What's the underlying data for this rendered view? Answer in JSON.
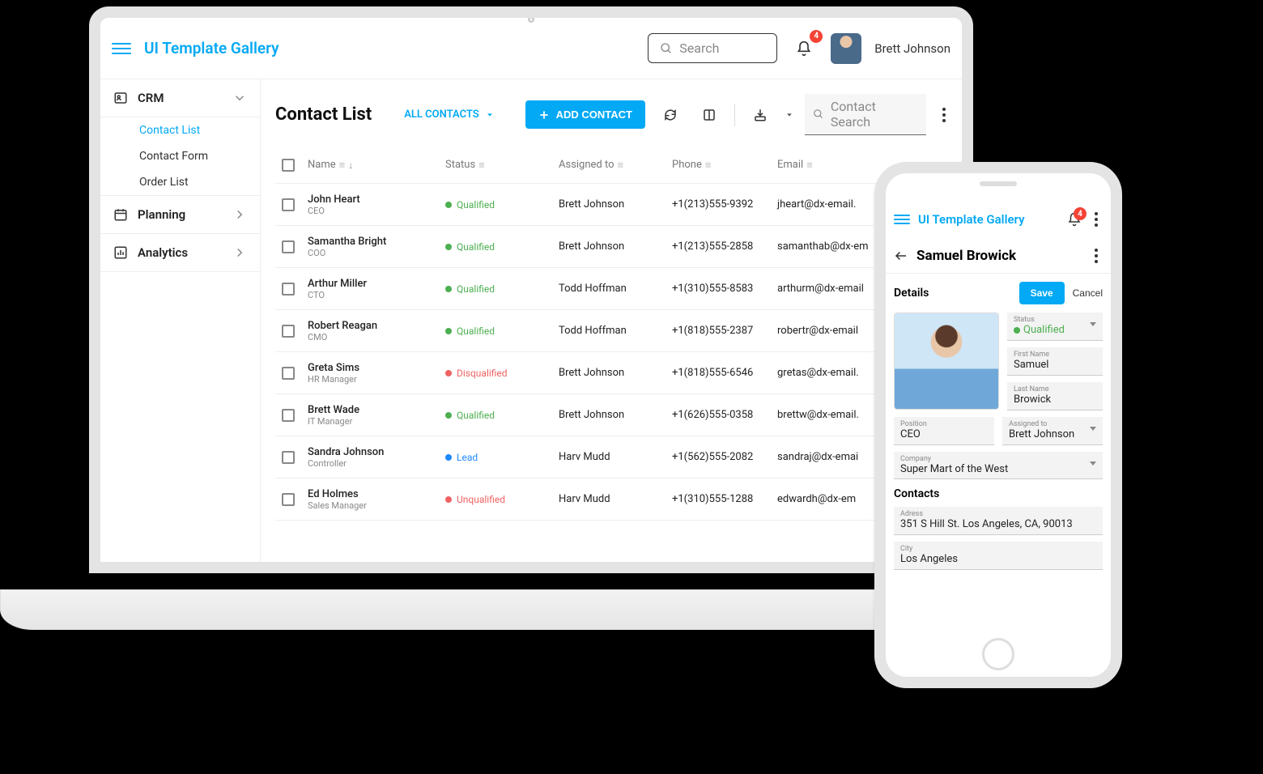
{
  "app_title": "UI Template Gallery",
  "search_placeholder": "Search",
  "notification_count": "4",
  "user_name": "Brett Johnson",
  "sidebar": {
    "sections": [
      {
        "label": "CRM",
        "icon": "contact-card-icon",
        "expanded": true,
        "items": [
          {
            "label": "Contact List",
            "active": true
          },
          {
            "label": "Contact Form",
            "active": false
          },
          {
            "label": "Order List",
            "active": false
          }
        ]
      },
      {
        "label": "Planning",
        "icon": "calendar-icon",
        "expanded": false,
        "items": []
      },
      {
        "label": "Analytics",
        "icon": "chart-icon",
        "expanded": false,
        "items": []
      }
    ]
  },
  "main": {
    "page_title": "Contact List",
    "filter_label": "ALL CONTACTS",
    "add_button_label": "ADD CONTACT",
    "contact_search_placeholder": "Contact Search",
    "columns": {
      "name": "Name",
      "status": "Status",
      "assigned": "Assigned to",
      "phone": "Phone",
      "email": "Email"
    },
    "rows": [
      {
        "name": "John Heart",
        "role": "CEO",
        "status": "Qualified",
        "assigned": "Brett Johnson",
        "phone": "+1(213)555-9392",
        "email": "jheart@dx-email."
      },
      {
        "name": "Samantha Bright",
        "role": "COO",
        "status": "Qualified",
        "assigned": "Brett Johnson",
        "phone": "+1(213)555-2858",
        "email": "samanthab@dx-em"
      },
      {
        "name": "Arthur Miller",
        "role": "CTO",
        "status": "Qualified",
        "assigned": "Todd Hoffman",
        "phone": "+1(310)555-8583",
        "email": "arthurm@dx-email"
      },
      {
        "name": "Robert Reagan",
        "role": "CMO",
        "status": "Qualified",
        "assigned": "Todd Hoffman",
        "phone": "+1(818)555-2387",
        "email": "robertr@dx-email"
      },
      {
        "name": "Greta Sims",
        "role": "HR Manager",
        "status": "Disqualified",
        "assigned": "Brett Johnson",
        "phone": "+1(818)555-6546",
        "email": "gretas@dx-email."
      },
      {
        "name": "Brett Wade",
        "role": "IT Manager",
        "status": "Qualified",
        "assigned": "Brett Johnson",
        "phone": "+1(626)555-0358",
        "email": "brettw@dx-email."
      },
      {
        "name": "Sandra Johnson",
        "role": "Controller",
        "status": "Lead",
        "assigned": "Harv Mudd",
        "phone": "+1(562)555-2082",
        "email": "sandraj@dx-emai"
      },
      {
        "name": "Ed Holmes",
        "role": "Sales Manager",
        "status": "Unqualified",
        "assigned": "Harv Mudd",
        "phone": "+1(310)555-1288",
        "email": "edwardh@dx-em"
      }
    ]
  },
  "phone": {
    "app_title": "UI Template Gallery",
    "notification_count": "4",
    "contact_name": "Samuel Browick",
    "details_label": "Details",
    "save_label": "Save",
    "cancel_label": "Cancel",
    "fields": {
      "status": {
        "label": "Status",
        "value": "Qualified"
      },
      "first_name": {
        "label": "First Name",
        "value": "Samuel"
      },
      "last_name": {
        "label": "Last Name",
        "value": "Browick"
      },
      "position": {
        "label": "Position",
        "value": "CEO"
      },
      "assigned": {
        "label": "Assigned to",
        "value": "Brett Johnson"
      },
      "company": {
        "label": "Company",
        "value": "Super Mart of the West"
      }
    },
    "contacts_section_label": "Contacts",
    "address": {
      "label": "Adress",
      "value": "351 S Hill St. Los Angeles, CA, 90013"
    },
    "city": {
      "label": "City",
      "value": "Los Angeles"
    }
  },
  "colors": {
    "accent": "#03a9f4",
    "success": "#4caf50",
    "danger": "#f06262",
    "info": "#1e88ff"
  }
}
